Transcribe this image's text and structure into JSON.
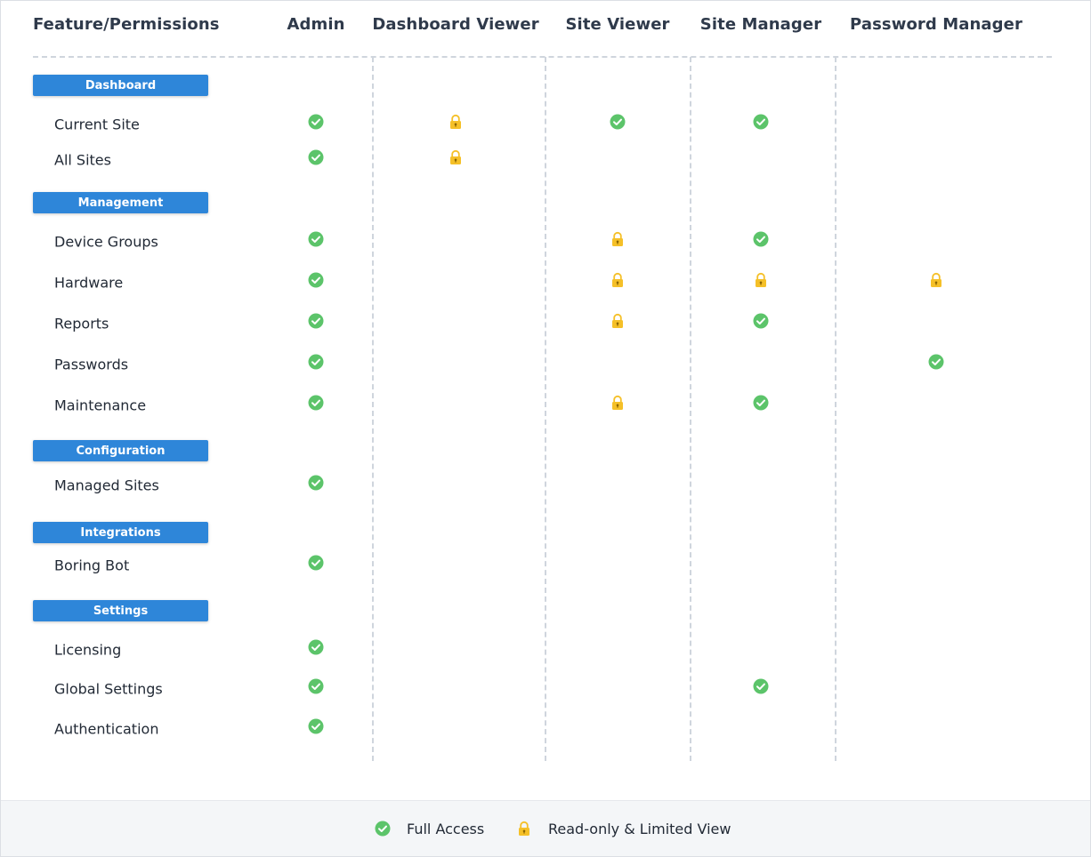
{
  "colors": {
    "accent": "#2e86d9",
    "full_access": "#5cc46a",
    "read_only": "#f5c028"
  },
  "headers": {
    "feature": "Feature/Permissions",
    "roles": [
      "Admin",
      "Dashboard Viewer",
      "Site  Viewer",
      "Site  Manager",
      "Password  Manager"
    ]
  },
  "sections": [
    {
      "label": "Dashboard",
      "rows": [
        {
          "label": "Current Site",
          "access": [
            "full",
            "read",
            "full",
            "full",
            null
          ]
        },
        {
          "label": "All Sites",
          "access": [
            "full",
            "read",
            null,
            null,
            null
          ]
        }
      ]
    },
    {
      "label": "Management",
      "rows": [
        {
          "label": "Device Groups",
          "access": [
            "full",
            null,
            "read",
            "full",
            null
          ]
        },
        {
          "label": "Hardware",
          "access": [
            "full",
            null,
            "read",
            "read",
            "read"
          ]
        },
        {
          "label": "Reports",
          "access": [
            "full",
            null,
            "read",
            "full",
            null
          ]
        },
        {
          "label": "Passwords",
          "access": [
            "full",
            null,
            null,
            null,
            "full"
          ]
        },
        {
          "label": "Maintenance",
          "access": [
            "full",
            null,
            "read",
            "full",
            null
          ]
        }
      ]
    },
    {
      "label": "Configuration",
      "rows": [
        {
          "label": "Managed Sites",
          "access": [
            "full",
            null,
            null,
            null,
            null
          ]
        }
      ]
    },
    {
      "label": "Integrations",
      "rows": [
        {
          "label": "Boring Bot",
          "access": [
            "full",
            null,
            null,
            null,
            null
          ]
        }
      ]
    },
    {
      "label": "Settings",
      "rows": [
        {
          "label": "Licensing",
          "access": [
            "full",
            null,
            null,
            null,
            null
          ]
        },
        {
          "label": "Global Settings",
          "access": [
            "full",
            null,
            null,
            "full",
            null
          ]
        },
        {
          "label": "Authentication",
          "access": [
            "full",
            null,
            null,
            null,
            null
          ]
        }
      ]
    }
  ],
  "legend": {
    "full_label": "Full Access",
    "read_label": "Read-only & Limited View",
    "full_icon": "check-circle-icon",
    "read_icon": "lock-icon"
  }
}
